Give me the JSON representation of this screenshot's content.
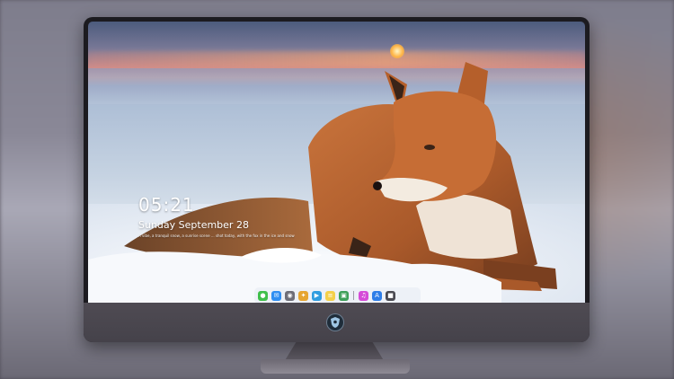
{
  "lock_screen": {
    "time": "05:21",
    "date": "Sunday September  28",
    "note": "A vibe, a tranquil snow, a sunrise scene ... shot today, with the fox in the ice and snow"
  },
  "dock": {
    "items": [
      {
        "icon": "messages-icon",
        "color": "#3fbf4a",
        "glyph": "●"
      },
      {
        "icon": "mail-icon",
        "color": "#2f8ef2",
        "glyph": "✉"
      },
      {
        "icon": "system-icon",
        "color": "#6e6e78",
        "glyph": "◉"
      },
      {
        "icon": "photos-icon",
        "color": "#e6a530",
        "glyph": "✦"
      },
      {
        "icon": "media-icon",
        "color": "#2f9de0",
        "glyph": "▶"
      },
      {
        "icon": "notes-icon",
        "color": "#f4d04a",
        "glyph": "≡"
      },
      {
        "icon": "preview-icon",
        "color": "#3d9f58",
        "glyph": "▣"
      },
      {
        "icon": "music-icon",
        "color": "#d54bd8",
        "glyph": "♫"
      },
      {
        "icon": "appstore-icon",
        "color": "#2e7ee8",
        "glyph": "A"
      },
      {
        "icon": "camera-icon",
        "color": "#4a4a52",
        "glyph": "■"
      }
    ]
  },
  "monitor": {
    "logo_icon": "shield-logo-icon",
    "accent": "#1f2d3a"
  }
}
